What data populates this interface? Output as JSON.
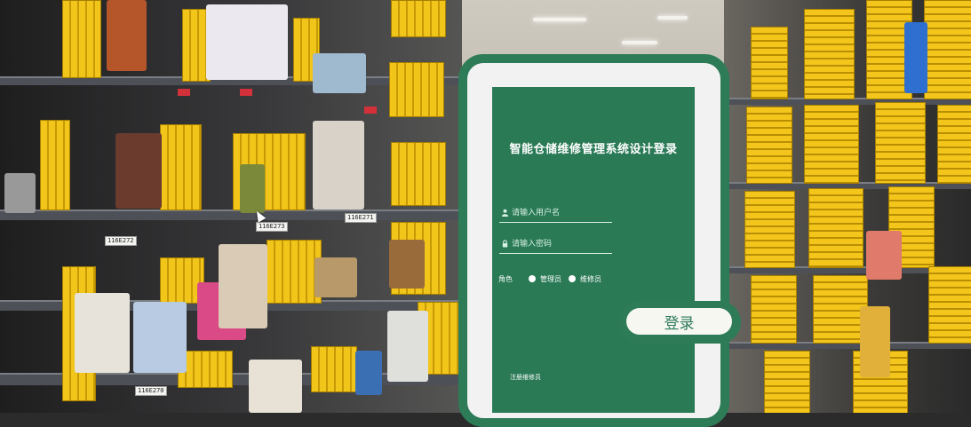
{
  "login": {
    "title": "智能仓储维修管理系统设计登录",
    "username_placeholder": "请输入用户名",
    "password_placeholder": "请输入密码",
    "role_label": "角色",
    "role_options": [
      "管理员",
      "维修员"
    ],
    "submit_label": "登录",
    "register_link": "注册维修员"
  },
  "shelf_tags": [
    "116E272",
    "116E273",
    "116E271",
    "116E270"
  ],
  "colors": {
    "brand_green": "#2e7b57",
    "panel_green": "#2a7a56",
    "bin_yellow": "#f2c51a"
  },
  "icons": {
    "username": "user-icon",
    "password": "lock-icon"
  }
}
